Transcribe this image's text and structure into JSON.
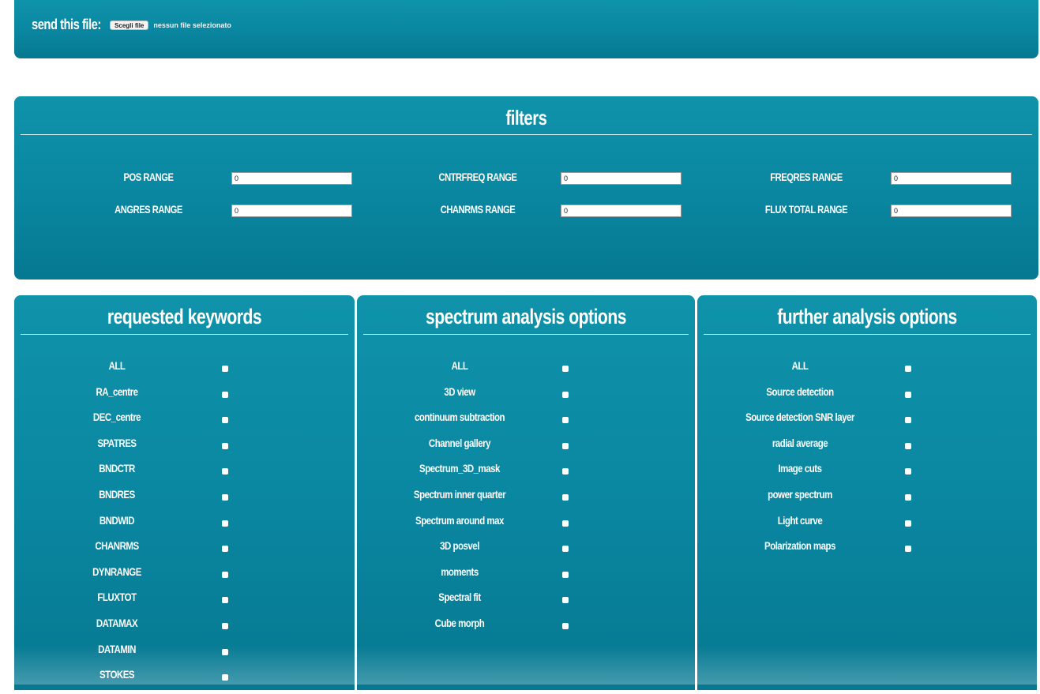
{
  "upload": {
    "label": "send this file:",
    "button_label": "Scegli file",
    "status": "nessun file selezionato"
  },
  "filters": {
    "title": "filters",
    "fields": [
      {
        "label": "POS RANGE",
        "value": "0"
      },
      {
        "label": "CNTRFREQ RANGE",
        "value": "0"
      },
      {
        "label": "FREQRES RANGE",
        "value": "0"
      },
      {
        "label": "ANGRES RANGE",
        "value": "0"
      },
      {
        "label": "CHANRMS RANGE",
        "value": "0"
      },
      {
        "label": "FLUX TOTAL RANGE",
        "value": "0"
      }
    ]
  },
  "keywords": {
    "title": "requested keywords",
    "items": [
      "ALL",
      "RA_centre",
      "DEC_centre",
      "SPATRES",
      "BNDCTR",
      "BNDRES",
      "BNDWID",
      "CHANRMS",
      "DYNRANGE",
      "FLUXTOT",
      "DATAMAX",
      "DATAMIN",
      "STOKES"
    ]
  },
  "spectrum": {
    "title": "spectrum analysis options",
    "items": [
      "ALL",
      "3D view",
      "continuum subtraction",
      "Channel gallery",
      "Spectrum_3D_mask",
      "Spectrum inner quarter",
      "Spectrum around max",
      "3D posvel",
      "moments",
      "Spectral fit",
      "Cube morph"
    ]
  },
  "further": {
    "title": "further analysis options",
    "items": [
      "ALL",
      "Source detection",
      "Source detection SNR layer",
      "radial average",
      "Image cuts",
      "power spectrum",
      "Light curve",
      "Polarization maps"
    ]
  },
  "colors": {
    "panel": "#0a86a0",
    "text": "#ffffff"
  }
}
